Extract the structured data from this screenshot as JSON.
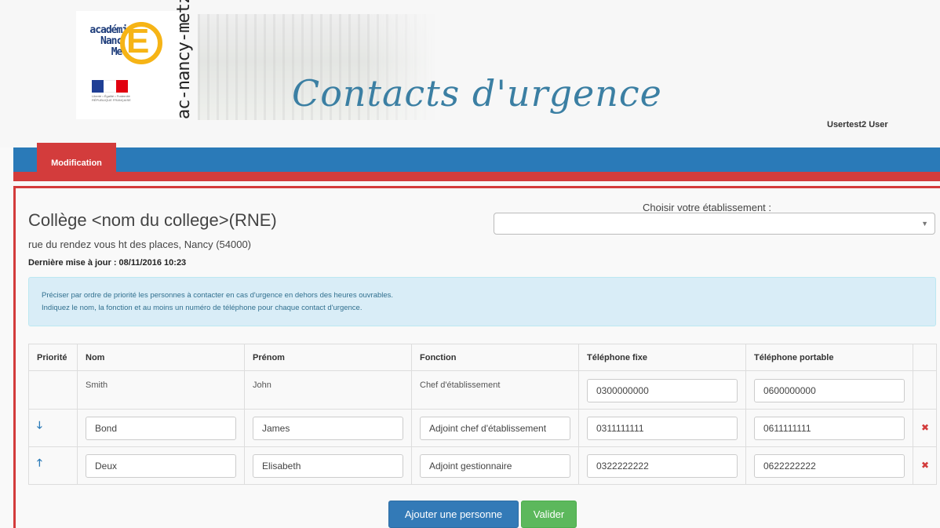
{
  "header": {
    "logo_academie": "académie\nNancy-Metz",
    "logo_letter": "É",
    "flag_caption": "Liberté • Égalité • Fraternité RÉPUBLIQUE FRANÇAISE",
    "domain_text": "ac-nancy-metz.fr",
    "app_title": "Contacts d'urgence",
    "user_name": "Usertest2 User"
  },
  "nav": {
    "active_tab": "Modification"
  },
  "establishment": {
    "name": "Collège <nom du college>(RNE)",
    "address": "rue du rendez vous ht des places, Nancy (54000)",
    "last_update": "Dernière mise à jour : 08/11/2016 10:23",
    "select_label": "Choisir votre établissement :",
    "select_value": ""
  },
  "info": {
    "line1": "Préciser par ordre de priorité les personnes à contacter en cas d'urgence en dehors des heures ouvrables.",
    "line2": "Indiquez le nom, la fonction et au moins un numéro de téléphone pour chaque contact d'urgence."
  },
  "table": {
    "headers": [
      "Priorité",
      "Nom",
      "Prénom",
      "Fonction",
      "Téléphone fixe",
      "Téléphone portable",
      ""
    ],
    "rows": [
      {
        "priority": "",
        "nom": "Smith",
        "prenom": "John",
        "fonction": "Chef d'établissement",
        "fixe": "0300000000",
        "portable": "0600000000",
        "removable": false
      },
      {
        "priority": "down",
        "nom": "Bond",
        "prenom": "James",
        "fonction": "Adjoint chef d'établissement",
        "fixe": "0311111111",
        "portable": "0611111111",
        "removable": true
      },
      {
        "priority": "up",
        "nom": "Deux",
        "prenom": "Elisabeth",
        "fonction": "Adjoint gestionnaire",
        "fixe": "0322222222",
        "portable": "0622222222",
        "removable": true
      }
    ],
    "arrow_down_glyph": "🡓",
    "arrow_up_glyph": "🡑",
    "remove_glyph": "✖"
  },
  "buttons": {
    "add_person": "Ajouter une personne",
    "validate": "Valider"
  },
  "colors": {
    "nav_blue": "#2a7ab8",
    "accent_red": "#d33c3c",
    "title_blue": "#3b7fa3",
    "info_bg": "#d9edf7",
    "btn_primary": "#337ab7",
    "btn_success": "#5cb85c",
    "logo_yellow": "#f6b416"
  }
}
